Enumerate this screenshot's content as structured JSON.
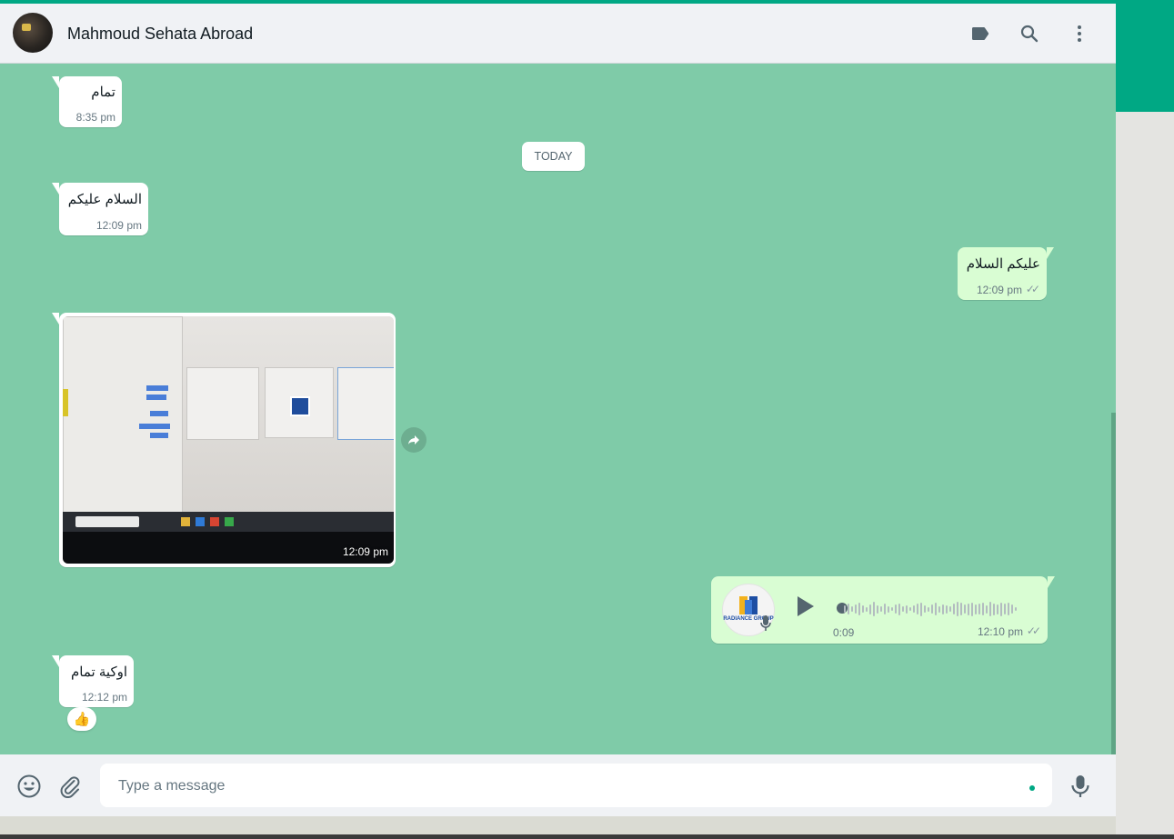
{
  "header": {
    "contact_name": "Mahmoud Sehata Abroad",
    "icons": [
      "label-icon",
      "search-icon",
      "menu-icon"
    ]
  },
  "date_divider": "TODAY",
  "messages": [
    {
      "direction": "in",
      "text": "تمام",
      "time": "8:35 pm"
    },
    {
      "direction": "in",
      "text": "السلام عليكم",
      "time": "12:09 pm"
    },
    {
      "direction": "out",
      "text": "عليكم السلام",
      "time": "12:09 pm",
      "status": "read"
    },
    {
      "direction": "in",
      "type": "image",
      "time": "12:09 pm"
    },
    {
      "direction": "out",
      "type": "voice",
      "duration": "0:09",
      "time": "12:10 pm",
      "status": "read",
      "avatar_label": "RADIANCE GROUP"
    },
    {
      "direction": "in",
      "text": "اوكية تمام",
      "time": "12:12 pm",
      "reaction": "👍"
    }
  ],
  "composer": {
    "placeholder": "Type a message",
    "icons": [
      "emoji-icon",
      "attach-icon",
      "mic-icon"
    ]
  },
  "colors": {
    "accent": "#00a884",
    "chat_background": "#7fcba8",
    "outgoing_bubble": "#d9fdd3",
    "incoming_bubble": "#ffffff"
  }
}
